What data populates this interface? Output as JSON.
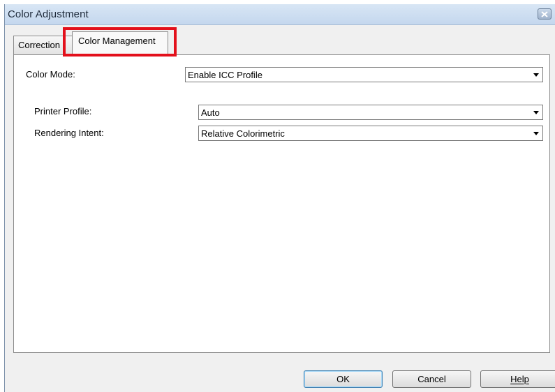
{
  "window": {
    "title": "Color Adjustment"
  },
  "tabs": [
    {
      "label": "Correction",
      "selected": false
    },
    {
      "label": "Color Management",
      "selected": true
    }
  ],
  "fields": {
    "color_mode": {
      "label": "Color Mode:",
      "value": "Enable ICC Profile"
    },
    "printer_profile": {
      "label": "Printer Profile:",
      "value": "Auto"
    },
    "rendering_intent": {
      "label": "Rendering Intent:",
      "value": "Relative Colorimetric"
    }
  },
  "buttons": {
    "ok": "OK",
    "cancel": "Cancel",
    "help": "Help"
  },
  "colors": {
    "highlight": "#e3101b",
    "titlebar": "#c4d7ee",
    "dialog_bg": "#f0f0f0"
  },
  "icons": {
    "close": "close-icon",
    "dropdown": "chevron-down-icon"
  }
}
